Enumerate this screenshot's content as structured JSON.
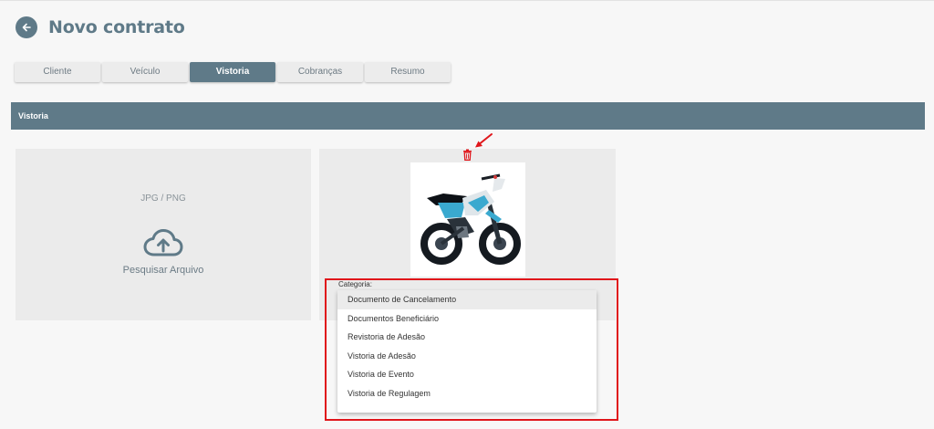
{
  "header": {
    "title": "Novo contrato",
    "back_icon": "arrow-left-icon"
  },
  "tabs": [
    {
      "label": "Cliente",
      "active": false
    },
    {
      "label": "Veículo",
      "active": false
    },
    {
      "label": "Vistoria",
      "active": true
    },
    {
      "label": "Cobranças",
      "active": false
    },
    {
      "label": "Resumo",
      "active": false
    }
  ],
  "section": {
    "title": "Vistoria"
  },
  "upload": {
    "formats": "JPG / PNG",
    "label": "Pesquisar Arquivo",
    "icon": "cloud-upload-icon"
  },
  "image_card": {
    "delete_icon": "trash-icon",
    "image": "dirt-bike-photo"
  },
  "category": {
    "label": "Categoria:",
    "options": [
      "Documento de Cancelamento",
      "Documentos Beneficiário",
      "Revistoria de Adesão",
      "Vistoria de Adesão",
      "Vistoria de Evento",
      "Vistoria de Regulagem"
    ]
  },
  "colors": {
    "primary": "#5f7a88",
    "highlight": "#e0161b",
    "card": "#ebebeb",
    "background": "#f7f7f7"
  }
}
